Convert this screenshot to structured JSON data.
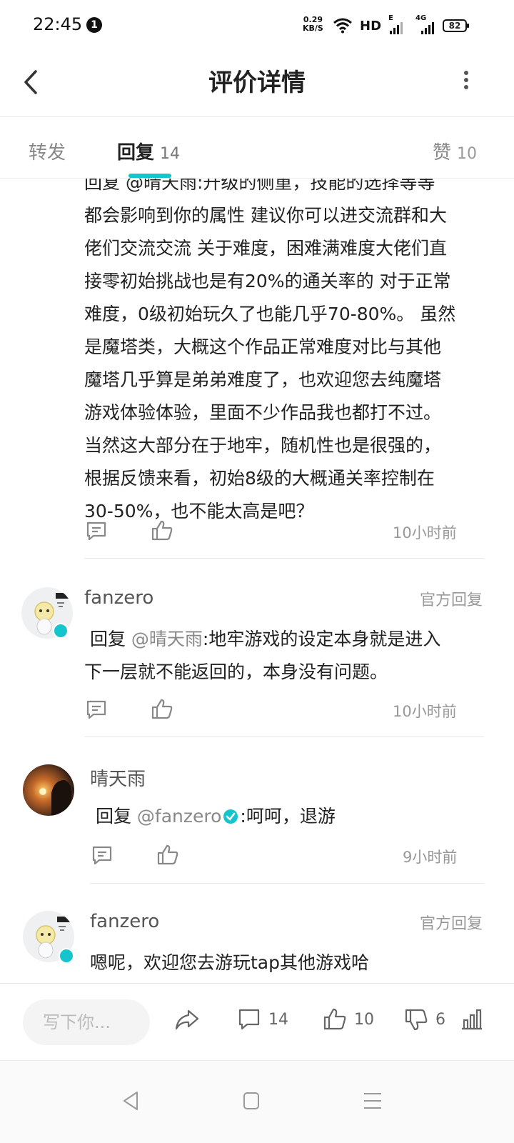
{
  "status_bar": {
    "time": "22:45",
    "notification_count": "1",
    "net_speed_value": "0.29",
    "net_speed_unit": "KB/S",
    "hd_label": "HD",
    "signal1_tag": "E",
    "signal2_tag": "4G",
    "battery": "82"
  },
  "header": {
    "title": "评价详情"
  },
  "tabs": [
    {
      "label": "转发",
      "count": ""
    },
    {
      "label": "回复",
      "count": "14"
    },
    {
      "label": "赞",
      "count": "10"
    }
  ],
  "comments": [
    {
      "username": "",
      "official": "",
      "lines": [
        "回复 @晴天雨:升级的侧重，技能的选择等等",
        "都会影响到你的属性 建议你可以进交流群和大",
        "佬们交流交流 关于难度，困难满难度大佬们直",
        "接零初始挑战也是有20%的通关率的 对于正常",
        "难度，0级初始玩久了也能几乎70-80%。 虽然",
        "是魔塔类，大概这个作品正常难度对比与其他",
        "魔塔几乎算是弟弟难度了，也欢迎您去纯魔塔",
        "游戏体验体验，里面不少作品我也都打不过。",
        "当然这大部分在于地牢，随机性也是很强的，",
        "根据反馈来看，初始8级的大概通关率控制在",
        "30-50%，也不能太高是吧？"
      ],
      "time": "10小时前"
    },
    {
      "username": "fanzero",
      "official": "官方回复",
      "reply_prefix": "回复 ",
      "mention": "@晴天雨",
      "text_line1": ":地牢游戏的设定本身就是进入",
      "text_line2": "下一层就不能返回的，本身没有问题。",
      "time": "10小时前"
    },
    {
      "username": "晴天雨",
      "official": "",
      "reply_prefix": "回复 ",
      "mention": "@fanzero",
      "text": ":呵呵，退游",
      "time": "9小时前"
    },
    {
      "username": "fanzero",
      "official": "官方回复",
      "text": "嗯呢，欢迎您去游玩tap其他游戏哈"
    }
  ],
  "bottom_bar": {
    "input_placeholder": "写下你...",
    "comment_count": "14",
    "like_count": "10",
    "dislike_count": "6"
  },
  "colors": {
    "accent": "#15c5ce",
    "text_primary": "#222222",
    "text_secondary": "#999999"
  }
}
